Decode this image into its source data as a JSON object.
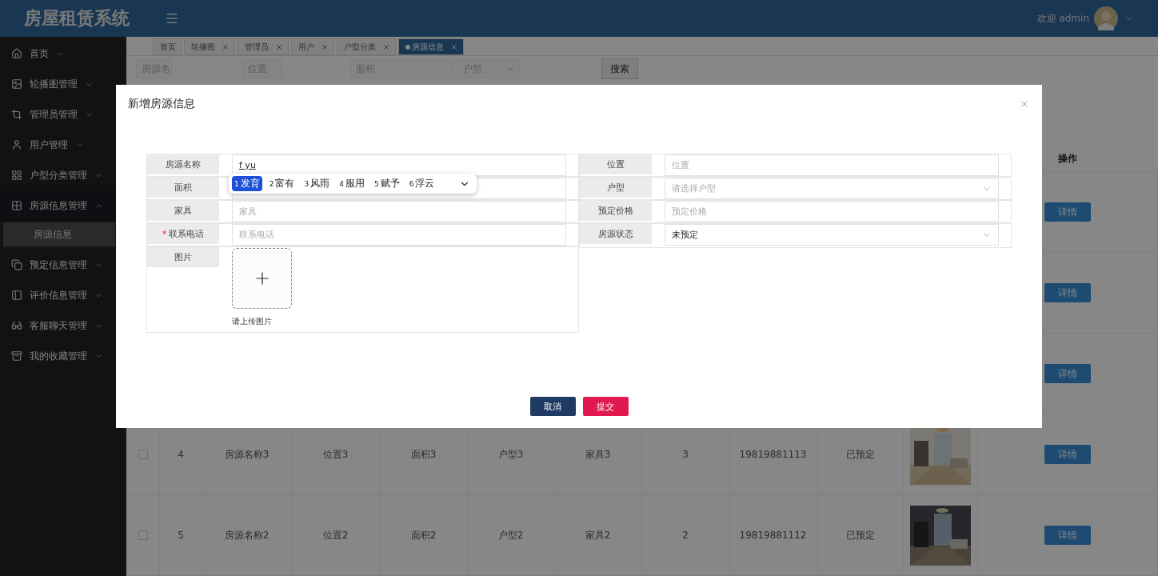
{
  "header": {
    "title": "房屋租赁系统",
    "welcome": "欢迎 admin"
  },
  "sidebar": {
    "items": [
      {
        "label": "首页",
        "expanded": false
      },
      {
        "label": "轮播图管理",
        "expanded": false
      },
      {
        "label": "管理员管理",
        "expanded": false
      },
      {
        "label": "用户管理",
        "expanded": false
      },
      {
        "label": "户型分类管理",
        "expanded": false
      },
      {
        "label": "房源信息管理",
        "expanded": true,
        "children": [
          {
            "label": "房源信息",
            "selected": true
          }
        ]
      },
      {
        "label": "预定信息管理",
        "expanded": false
      },
      {
        "label": "评价信息管理",
        "expanded": false
      },
      {
        "label": "客服聊天管理",
        "expanded": false
      },
      {
        "label": "我的收藏管理",
        "expanded": false
      }
    ]
  },
  "tabs": [
    {
      "label": "首页",
      "closable": false,
      "selected": false
    },
    {
      "label": "轮播图",
      "closable": true,
      "selected": false
    },
    {
      "label": "管理员",
      "closable": true,
      "selected": false
    },
    {
      "label": "用户",
      "closable": true,
      "selected": false
    },
    {
      "label": "户型分类",
      "closable": true,
      "selected": false
    },
    {
      "label": "房源信息",
      "closable": true,
      "selected": true
    }
  ],
  "filters": [
    {
      "kind": "input",
      "placeholder": "房源名"
    },
    {
      "kind": "input",
      "placeholder": "位置"
    },
    {
      "kind": "input",
      "placeholder": "面积"
    },
    {
      "kind": "select",
      "placeholder": "户型"
    }
  ],
  "search_button": "搜索",
  "table": {
    "action_header": "操作",
    "rows": [
      {
        "action": "详情"
      },
      {
        "action": "详情"
      },
      {
        "action": "详情"
      },
      {
        "checked": false,
        "index": "4",
        "name": "房源名称3",
        "position": "位置3",
        "area": "面积3",
        "type": "户型3",
        "furniture": "家具3",
        "column_8": "3",
        "phone": "19819881113",
        "status": "已预定",
        "action": "详情"
      },
      {
        "checked": false,
        "index": "5",
        "name": "房源名称2",
        "position": "位置2",
        "area": "面积2",
        "type": "户型2",
        "furniture": "家具2",
        "column_8": "2",
        "phone": "19819881112",
        "status": "已预定",
        "action": "详情"
      }
    ]
  },
  "dialog": {
    "title": "新增房源信息",
    "left_fields": [
      {
        "label": "房源名称",
        "kind": "input",
        "value": "f yu"
      },
      {
        "label": "面积",
        "kind": "input"
      },
      {
        "label": "家具",
        "kind": "input",
        "placeholder": "家具"
      },
      {
        "label": "联系电话",
        "kind": "input",
        "placeholder": "联系电话",
        "required_mark": "*"
      },
      {
        "label": "图片",
        "kind": "upload",
        "hint": "请上传图片"
      }
    ],
    "right_fields": [
      {
        "label": "位置",
        "kind": "input",
        "placeholder": "位置"
      },
      {
        "label": "户型",
        "kind": "select",
        "placeholder": "请选择户型"
      },
      {
        "label": "预定价格",
        "kind": "input",
        "placeholder": "预定价格"
      },
      {
        "label": "房源状态",
        "kind": "select",
        "value": "未预定"
      }
    ],
    "ime_candidates": [
      {
        "number": "1",
        "text": "发育",
        "selected": true
      },
      {
        "number": "2",
        "text": "富有",
        "selected": false
      },
      {
        "number": "3",
        "text": "风雨",
        "selected": false
      },
      {
        "number": "4",
        "text": "服用",
        "selected": false
      },
      {
        "number": "5",
        "text": "赋予",
        "selected": false
      },
      {
        "number": "6",
        "text": "浮云",
        "selected": false
      }
    ],
    "buttons": [
      {
        "label": "取消",
        "kind": "cancel"
      },
      {
        "label": "提交",
        "kind": "submit"
      }
    ]
  }
}
